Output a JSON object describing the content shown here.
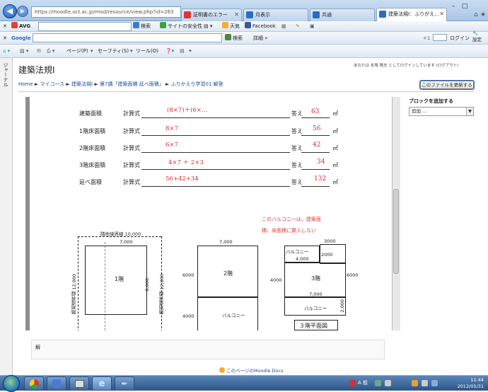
{
  "browser": {
    "address": "https://moodle.oct.ac.jp/mod/resource/view.php?id=263",
    "tabs": [
      {
        "label": "証明書のエラー",
        "active": false
      },
      {
        "label": "月表示",
        "active": false
      },
      {
        "label": "共通",
        "active": false
      },
      {
        "label": "建築法規Ⅰ：ふりがえ…",
        "active": true
      }
    ],
    "window_controls": {
      "minimize": "–",
      "restore": "□",
      "close": "✕"
    }
  },
  "avg_toolbar": {
    "close": "✕",
    "brand": "AVG",
    "search_label": "検索",
    "safety_label": "サイトの安全性",
    "weather_label": "天気",
    "facebook_label": "Facebook"
  },
  "google_toolbar": {
    "brand": "Google",
    "search_label": "検索",
    "more_label": "詳細 »",
    "sign_in": "ログイン",
    "settings": "設定"
  },
  "command_bar": {
    "page": "ページ(P)",
    "safety": "セーフティ(S)",
    "tools": "ツール(O)"
  },
  "left_strip": {
    "text": "ジャーナル"
  },
  "page": {
    "title": "建築法規Ⅰ",
    "login_info": "あなたは 玄場 晃志 としてログインしています (ログアウト)",
    "breadcrumb": {
      "home": "Home",
      "my_courses": "マイコース",
      "course": "建築法規Ⅰ",
      "section": "第7講「建築面積 延べ面積」",
      "resource": "ふりかえり学習01 解答",
      "sep": "►"
    },
    "update_button": "このファイルを更新する",
    "block_header": "ブロックを追加する",
    "block_select": "追加 ...",
    "solution_label": "解",
    "footer_link": "このページのMoodle Docs"
  },
  "document": {
    "rows": [
      {
        "label": "建築面積",
        "calc": "計算式",
        "formula": "(8×7)＋(6×…",
        "answer_label": "答え",
        "answer": "63",
        "unit": "㎡"
      },
      {
        "label": "1階床面積",
        "calc": "計算式",
        "formula": "8×7",
        "answer_label": "答え",
        "answer": "56",
        "unit": "㎡"
      },
      {
        "label": "2階床面積",
        "calc": "計算式",
        "formula": "6×7",
        "answer_label": "答え",
        "answer": "42",
        "unit": "㎡"
      },
      {
        "label": "3階床面積",
        "calc": "計算式",
        "formula": "4×7 ＋ 2×3",
        "answer_label": "答え",
        "answer": "34",
        "unit": "㎡"
      },
      {
        "label": "延べ面積",
        "calc": "計算式",
        "formula": "56+42+34",
        "answer_label": "答え",
        "answer": "132",
        "unit": "㎡"
      }
    ],
    "note_line1": "このバルコニーは、建築面",
    "note_line2": "積、床面積に算入しない",
    "plan1": {
      "boundary_top": "隣地境界線 10,000",
      "boundary_side": "隣地境界線 12,000",
      "boundary_side2": "隣地境界線 12,000",
      "width": "7,000",
      "depth": "8,000",
      "floor": "1階"
    },
    "plan2": {
      "width": "7,000",
      "depth": "6000",
      "floor": "2階",
      "balcony": "バルコニー",
      "balcony_depth": "4000"
    },
    "plan3": {
      "top": "3000",
      "balcony_top": "バルコニー",
      "balcony_width": "4,000",
      "step": "2000",
      "floor": "3階",
      "depth": "6000",
      "width": "7,000",
      "balcony_bottom": "バルコニー",
      "balcony_depth": "2,000",
      "side": "4000",
      "caption": "３階平面図"
    }
  },
  "taskbar": {
    "time": "11:44",
    "date": "2012/05/31",
    "ime": "A 般"
  }
}
